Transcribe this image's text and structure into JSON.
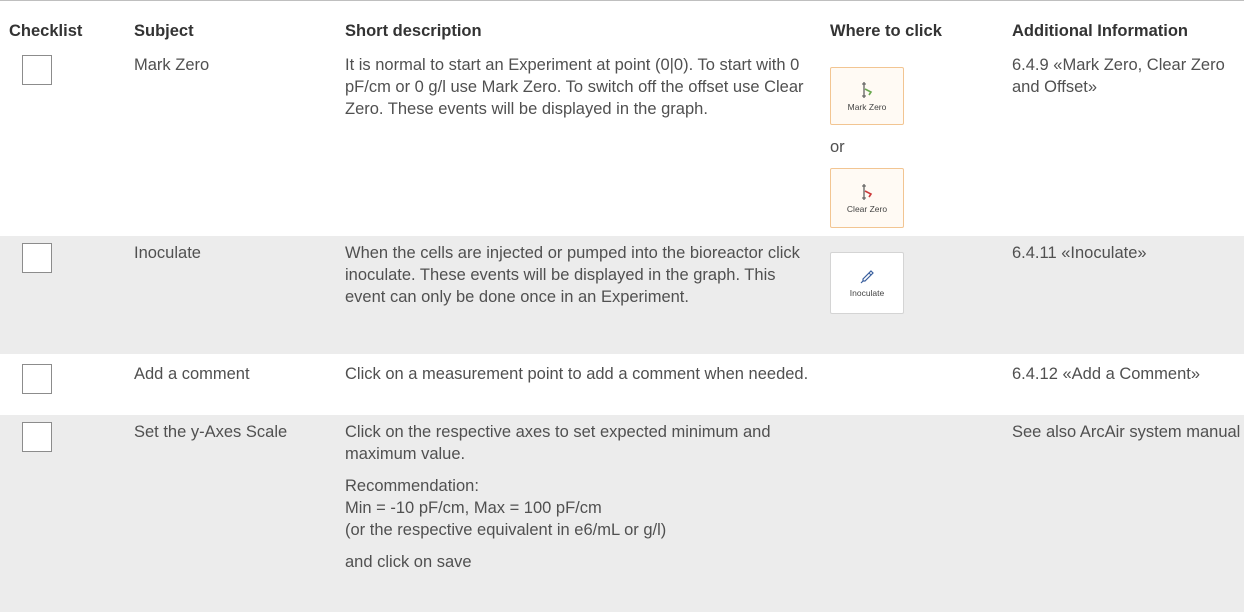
{
  "header": {
    "checklist": "Checklist",
    "subject": "Subject",
    "description": "Short description",
    "where": "Where to click",
    "info": "Additional Information"
  },
  "rows": [
    {
      "subject": "Mark Zero",
      "description": [
        "It is normal to start an Experiment at point (0|0). To start with 0 pF/cm or 0 g/l use Mark Zero. To switch off the offset use Clear Zero. These events will be displayed in the graph."
      ],
      "where": {
        "button1": "Mark Zero",
        "separator": "or",
        "button2": "Clear Zero"
      },
      "info": "6.4.9 «Mark Zero, Clear Zero and Offset»"
    },
    {
      "subject": "Inoculate",
      "description": [
        "When the cells are injected or pumped into the bioreactor click inoculate. These events will be displayed in the graph. This event can only be done once in an Experiment."
      ],
      "where": {
        "button1": "Inoculate"
      },
      "info": "6.4.11 «Inoculate»"
    },
    {
      "subject": "Add a comment",
      "description": [
        "Click on a measurement point to add a comment when needed."
      ],
      "info": "6.4.12 «Add a Comment»"
    },
    {
      "subject": "Set the y-Axes Scale",
      "description": [
        "Click on the respective axes to set expected minimum and maximum value.",
        "Recommendation:",
        "Min = -10 pF/cm, Max = 100 pF/cm",
        "(or the respective equivalent in e6/mL or g/l)",
        "and click on save"
      ],
      "info": "See also ArcAir system manual"
    }
  ],
  "icons": {
    "mark_zero": "mark-zero-icon",
    "clear_zero": "clear-zero-icon",
    "inoculate": "inoculate-icon"
  },
  "colors": {
    "stripe": "#ececec",
    "button_highlight_border": "#f2c592",
    "text": "#505050"
  }
}
